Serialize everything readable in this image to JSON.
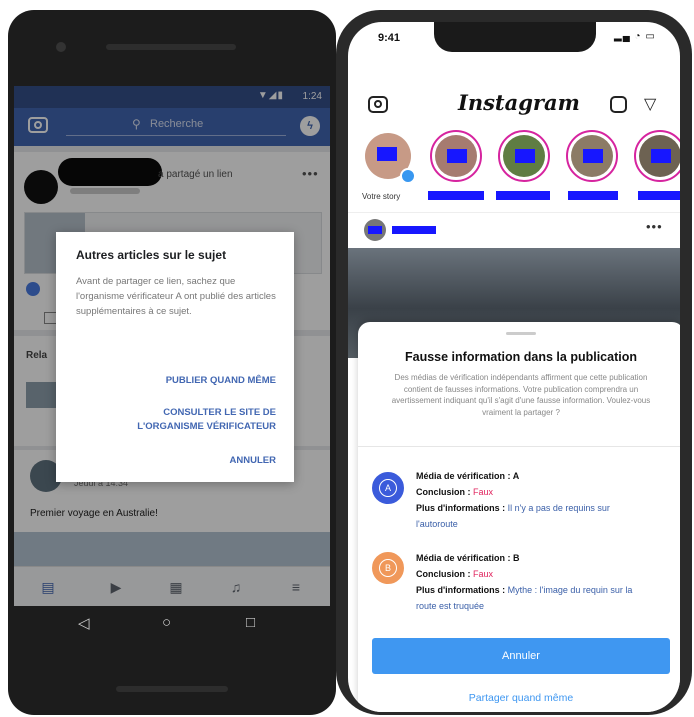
{
  "android": {
    "status_time": "1:24",
    "search_placeholder": "Recherche",
    "post": {
      "shared_text": "a partagé un lien"
    },
    "related_header": "Rela",
    "post2": {
      "date": "Jeudi à 14:34",
      "caption": "Premier voyage en Australie!"
    },
    "dialog": {
      "title": "Autres articles sur le sujet",
      "body": "Avant de partager ce lien, sachez que l'organisme vérificateur A ont publié des articles supplémentaires à ce sujet.",
      "publish_label": "PUBLIER QUAND MÊME",
      "consult_label_line1": "CONSULTER LE SITE DE",
      "consult_label_line2": "L'ORGANISME VÉRIFICATEUR",
      "cancel_label": "ANNULER"
    }
  },
  "iphone": {
    "status_time": "9:41",
    "app_title": "Instagram",
    "story_me_label": "Votre story",
    "sheet": {
      "title": "Fausse information dans la publication",
      "body": "Des médias de vérification indépendants affirment que cette publication contient de fausses informations. Votre publication comprendra un avertissement indiquant qu'il s'agit d'une fausse information. Voulez-vous vraiment la partager ?",
      "sources": [
        {
          "badge": "A",
          "badge_color": "#3b5bdb",
          "media_label": "Média de vérification : A",
          "conclusion_label": "Conclusion : ",
          "conclusion_value": "Faux",
          "info_label": "Plus d'informations : ",
          "info_value": "Il n'y a pas de requins sur l'autoroute"
        },
        {
          "badge": "B",
          "badge_color": "#f0985a",
          "media_label": "Média de vérification : B",
          "conclusion_label": "Conclusion : ",
          "conclusion_value": "Faux",
          "info_label": "Plus d'informations : ",
          "info_value": "Mythe : l'image du requin sur la route est truquée"
        }
      ],
      "cancel_label": "Annuler",
      "share_label": "Partager quand même"
    }
  }
}
